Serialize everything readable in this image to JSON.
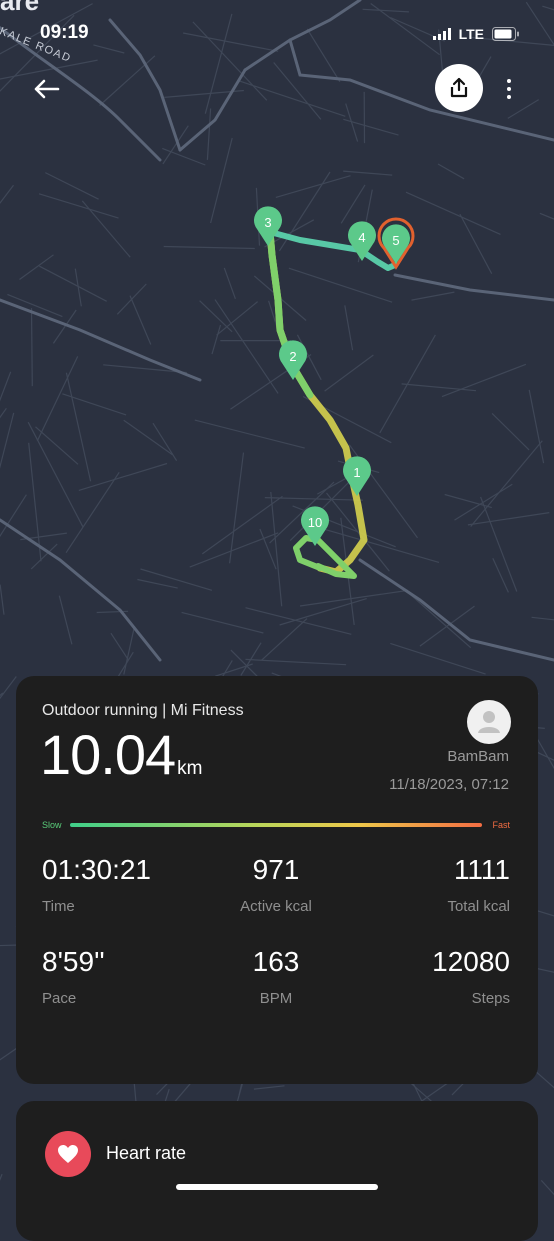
{
  "status": {
    "time": "09:19",
    "network": "LTE"
  },
  "map": {
    "road_label": "AKALE ROAD",
    "corner_text": "are",
    "markers": [
      "1",
      "2",
      "3",
      "4",
      "5",
      "10"
    ],
    "colors": {
      "marker": "#5cc98a",
      "end_marker": "#e2612e",
      "route_fast": "#d8d24a",
      "route_slow": "#58c8a6"
    }
  },
  "summary": {
    "title": "Outdoor running | Mi Fitness",
    "distance": "10.04",
    "distance_unit": "km",
    "user_name": "BamBam",
    "date": "11/18/2023, 07:12",
    "speed_scale": {
      "slow": "Slow",
      "fast": "Fast"
    },
    "stats": [
      {
        "value": "01:30:21",
        "label": "Time"
      },
      {
        "value": "971",
        "label": "Active kcal"
      },
      {
        "value": "1111",
        "label": "Total kcal"
      },
      {
        "value": "8'59''",
        "label": "Pace"
      },
      {
        "value": "163",
        "label": "BPM"
      },
      {
        "value": "12080",
        "label": "Steps"
      }
    ]
  },
  "heart_rate": {
    "label": "Heart rate",
    "accent": "#e84a5a"
  }
}
